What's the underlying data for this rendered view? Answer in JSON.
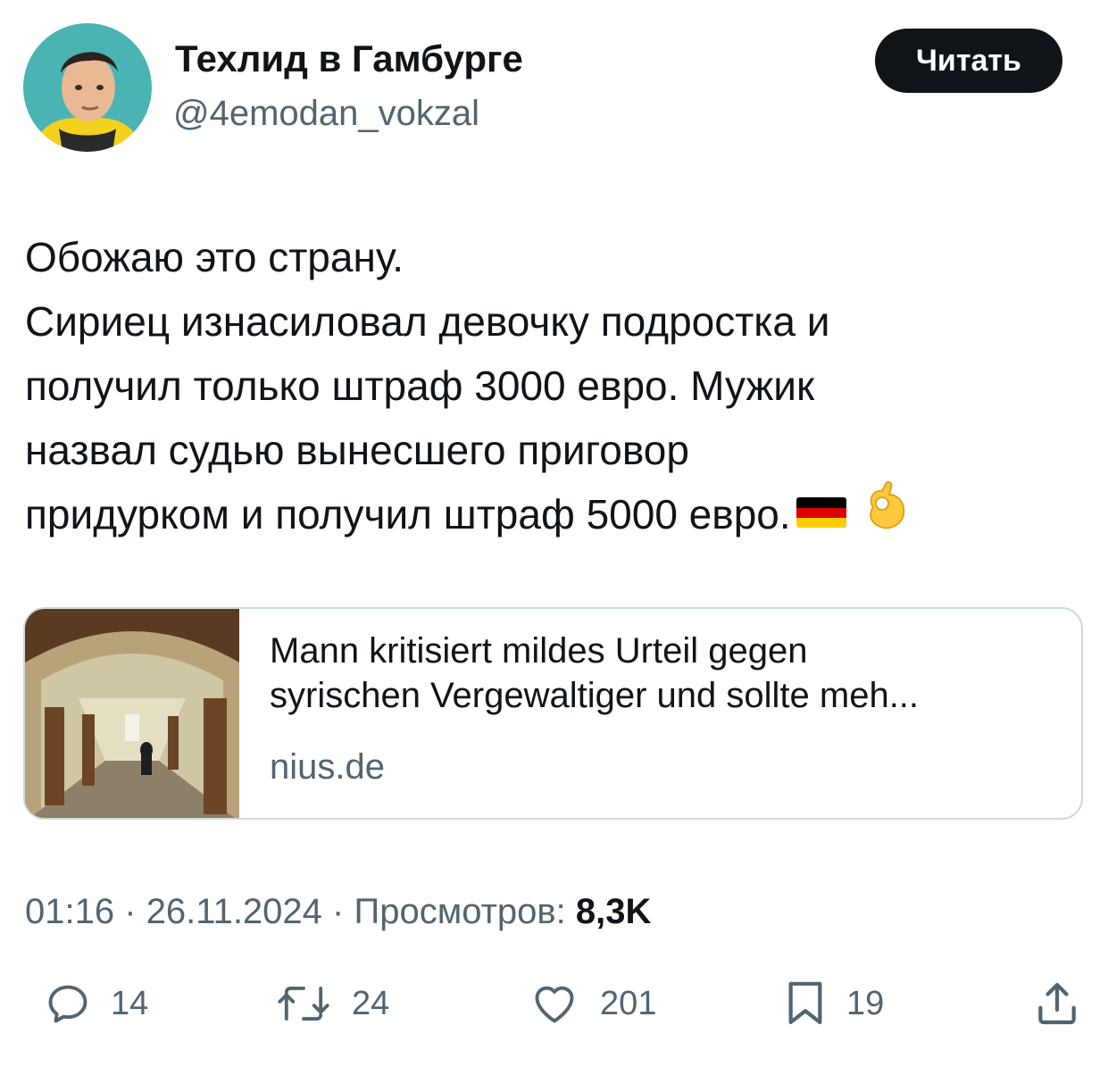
{
  "author": {
    "display_name": "Техлид в Гамбурге",
    "handle": "@4emodan_vokzal"
  },
  "follow_button_label": "Читать",
  "tweet": {
    "lines": [
      "Обожаю это страну.",
      "Сириец изнасиловал девочку подростка и",
      "получил только штраф 3000 евро. Мужик",
      "назвал судью вынесшего приговор",
      "придурком и получил штраф 5000 евро."
    ],
    "emojis": [
      "german-flag-emoji",
      "ok-hand-emoji"
    ]
  },
  "link_card": {
    "title_lines": [
      "Mann kritisiert mildes Urteil gegen",
      "syrischen Vergewaltiger und sollte meh..."
    ],
    "domain": "nius.de"
  },
  "meta": {
    "time": "01:16",
    "separator": "·",
    "date": "26.11.2024",
    "views_label": "Просмотров:",
    "views_count": "8,3K"
  },
  "actions": {
    "replies": "14",
    "reposts": "24",
    "likes": "201",
    "bookmarks": "19"
  },
  "colors": {
    "text_primary": "#0f1419",
    "text_secondary": "#536471",
    "card_border": "#cfd9de",
    "follow_button_bg": "#0f1419"
  }
}
